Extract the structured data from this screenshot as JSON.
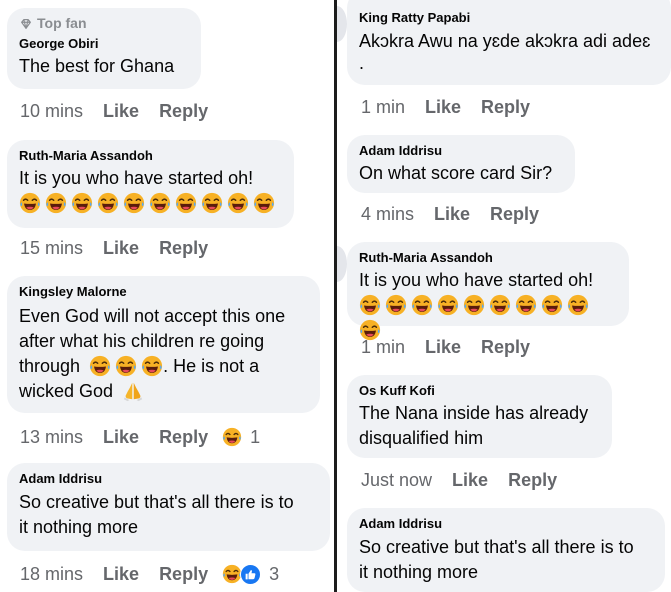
{
  "left": {
    "comments": [
      {
        "badge": "Top fan",
        "author": "George Obiri",
        "text": "The best for Ghana",
        "time": "10 mins",
        "like": "Like",
        "reply": "Reply"
      },
      {
        "author": "Ruth-Maria Assandoh",
        "text": "It is you who have started oh!",
        "emoji_count": 10,
        "time": "15 mins",
        "like": "Like",
        "reply": "Reply"
      },
      {
        "author": "Kingsley Malorne",
        "line1": "Even God will not accept this one",
        "line2": "after what his children re going",
        "line3a": "through",
        "line3b": ". He is not a",
        "line4": "wicked God",
        "time": "13 mins",
        "like": "Like",
        "reply": "Reply",
        "reaction_count": "1"
      },
      {
        "author": "Adam Iddrisu",
        "line1": "So creative but that's all there is to",
        "line2": "it nothing more",
        "time": "18 mins",
        "like": "Like",
        "reply": "Reply",
        "reaction_count": "3"
      }
    ]
  },
  "right": {
    "comments": [
      {
        "author": "King Ratty Papabi",
        "line1": "Akɔkra Awu na yɛde akɔkra adi adeɛ",
        "line2": ".",
        "time": "1 min",
        "like": "Like",
        "reply": "Reply"
      },
      {
        "author": "Adam Iddrisu",
        "text": "On what score card Sir?",
        "time": "4 mins",
        "like": "Like",
        "reply": "Reply"
      },
      {
        "author": "Ruth-Maria Assandoh",
        "text": "It is you who have started oh!",
        "emoji_count": 10,
        "time": "1 min",
        "like": "Like",
        "reply": "Reply"
      },
      {
        "author": "Os Kuff Kofi",
        "line1": "The Nana inside has already",
        "line2": "disqualified him",
        "time": "Just now",
        "like": "Like",
        "reply": "Reply"
      },
      {
        "author": "Adam Iddrisu",
        "line1": "So creative but that's all there is to",
        "line2": "it nothing more"
      }
    ]
  },
  "colors": {
    "bubble": "#f0f2f5",
    "meta_text": "#65676b",
    "like_blue": "#1877f2",
    "divider": "#1c1c1c"
  },
  "icons": {
    "top_fan": "diamond-icon",
    "laughing": "laughing-crying-emoji",
    "pray": "praying-hands-emoji",
    "like_reaction": "thumbs-up-icon"
  }
}
